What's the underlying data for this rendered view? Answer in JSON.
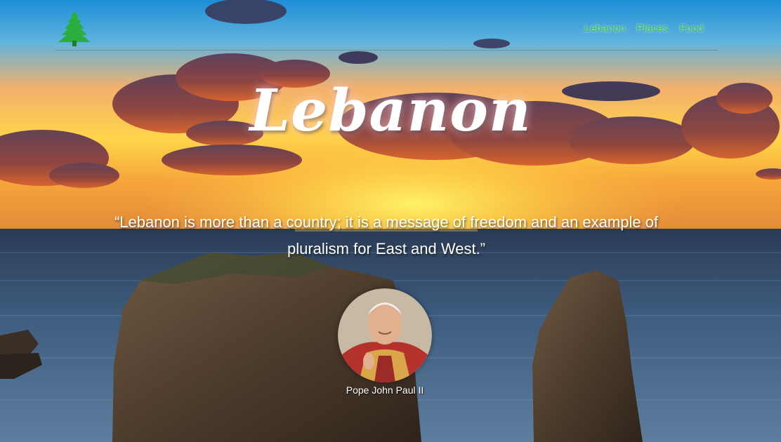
{
  "site": {
    "logo_icon": "cedar-tree-icon"
  },
  "nav": {
    "items": [
      {
        "label": "Lebanon"
      },
      {
        "label": "Places"
      },
      {
        "label": "Food"
      }
    ],
    "color": "#36c24e"
  },
  "hero": {
    "title": "Lebanon",
    "quote": "“Lebanon is more than a country; it is a message of freedom and an example of pluralism for East and West.”",
    "caption": "Pope John Paul II"
  }
}
